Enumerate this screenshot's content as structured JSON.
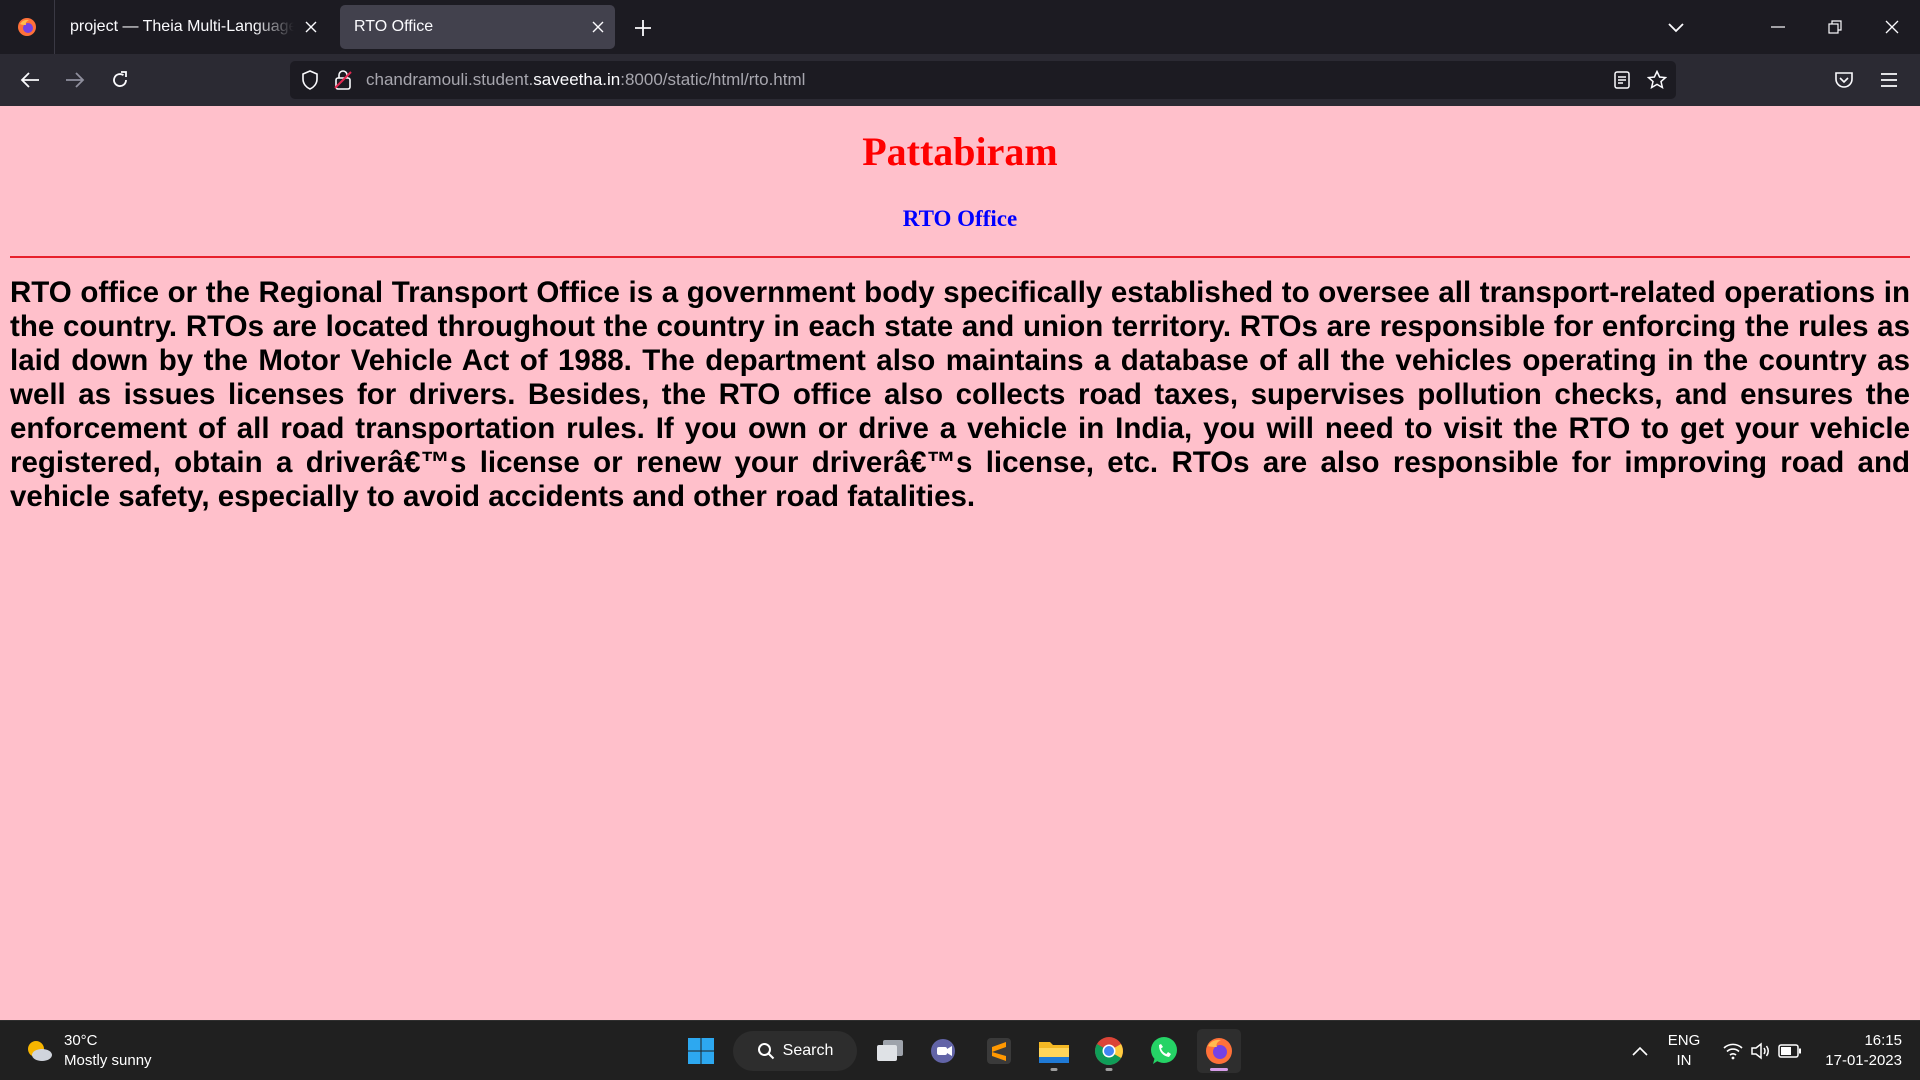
{
  "browser": {
    "tabs": [
      {
        "label": "project — Theia Multi-Language Ex",
        "active": false
      },
      {
        "label": "RTO Office",
        "active": true
      }
    ],
    "url": {
      "prefix": "chandramouli.student.",
      "host": "saveetha.in",
      "suffix": ":8000/static/html/rto.html"
    }
  },
  "page": {
    "heading": "Pattabiram",
    "subheading": "RTO Office",
    "paragraph": "RTO office or the Regional Transport Office is a government body specifically established to oversee all transport-related operations in the country. RTOs are located throughout the country in each state and union territory. RTOs are responsible for enforcing the rules as laid down by the Motor Vehicle Act of 1988. The department also maintains a database of all the vehicles operating in the country as well as issues licenses for drivers. Besides, the RTO office also collects road taxes, supervises pollution checks, and ensures the enforcement of all road transportation rules. If you own or drive a vehicle in India, you will need to visit the RTO to get your vehicle registered, obtain a driverâ€™s license or renew your driverâ€™s license, etc. RTOs are also responsible for improving road and vehicle safety, especially to avoid accidents and other road fatalities.",
    "colors": {
      "background": "#ffc0cb",
      "heading": "#ff0000",
      "subheading": "#0000ff",
      "rule": "#e8202c"
    }
  },
  "taskbar": {
    "weather": {
      "temp": "30°C",
      "condition": "Mostly sunny"
    },
    "search_label": "Search",
    "language": {
      "line1": "ENG",
      "line2": "IN"
    },
    "clock": {
      "time": "16:15",
      "date": "17-01-2023"
    }
  }
}
